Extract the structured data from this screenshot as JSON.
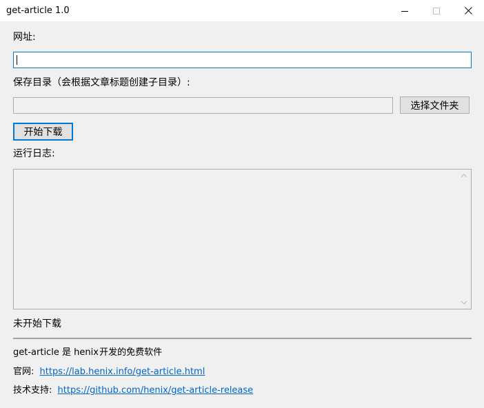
{
  "window": {
    "title": "get-article 1.0",
    "controls": {
      "minimize": "minimize-icon",
      "maximize": "maximize-icon",
      "close": "close-icon"
    }
  },
  "form": {
    "url_label": "网址:",
    "url_value": "",
    "dir_label": "保存目录（会根据文章标题创建子目录）:",
    "dir_value": "",
    "browse_button": "选择文件夹",
    "start_button": "开始下载",
    "log_label": "运行日志:",
    "log_content": ""
  },
  "status": {
    "text": "未开始下载"
  },
  "footer": {
    "about_app": "get-article",
    "about_is": "是",
    "about_author": "henix",
    "about_rest": "开发的免费软件",
    "website_label": "官网:",
    "website_url": "https://lab.henix.info/get-article.html",
    "support_label": "技术支持:",
    "support_url": "https://github.com/henix/get-article-release"
  },
  "colors": {
    "accent": "#0078d7",
    "link": "#0066cc",
    "background": "#f0f0f0"
  }
}
